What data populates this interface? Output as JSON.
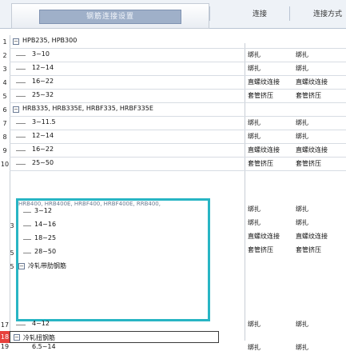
{
  "header": {
    "title": "钢筋连接设置",
    "col1": "连接",
    "col2": "连接方式"
  },
  "rows": [
    {
      "n": "1",
      "group": true,
      "label": "HPB235, HPB300"
    },
    {
      "n": "2",
      "label": "3~10",
      "c1": "绑扎",
      "c2": "绑扎"
    },
    {
      "n": "3",
      "label": "12~14",
      "c1": "绑扎",
      "c2": "绑扎"
    },
    {
      "n": "4",
      "label": "16~22",
      "c1": "直螺纹连接",
      "c2": "直螺纹连接"
    },
    {
      "n": "5",
      "label": "25~32",
      "c1": "套管挤压",
      "c2": "套管挤压"
    },
    {
      "n": "6",
      "group": true,
      "label": "HRB335, HRB335E, HRBF335, HRBF335E"
    },
    {
      "n": "7",
      "label": "3~11.5",
      "c1": "绑扎",
      "c2": "绑扎"
    },
    {
      "n": "8",
      "label": "12~14",
      "c1": "绑扎",
      "c2": "绑扎"
    },
    {
      "n": "9",
      "label": "16~22",
      "c1": "直螺纹连接",
      "c2": "直螺纹连接"
    },
    {
      "n": "10",
      "label": "25~50",
      "c1": "套管挤压",
      "c2": "套管挤压"
    }
  ],
  "popup": {
    "header": "HRB400, HRB400E, HRBF400, HRBF400E, RRB400,",
    "rows": [
      {
        "label": "3~12",
        "c1": "绑扎",
        "c2": "绑扎"
      },
      {
        "n": "3",
        "label": "14~16",
        "c1": "绑扎",
        "c2": "绑扎"
      },
      {
        "label": "18~25",
        "c1": "直螺纹连接",
        "c2": "直螺纹连接"
      },
      {
        "n": "5",
        "label": "28~50",
        "c1": "套管挤压",
        "c2": "套管挤压"
      },
      {
        "n": "5",
        "group": true,
        "label": "冷轧带肋钢筋"
      }
    ]
  },
  "tail_rows": [
    {
      "n": "17",
      "label": "4~12",
      "c1": "绑扎",
      "c2": "绑扎"
    },
    {
      "n": "18",
      "group": true,
      "label": "冷轧扭钢筋"
    },
    {
      "n": "19",
      "label": "6.5~14",
      "c1": "绑扎",
      "c2": "绑扎"
    }
  ]
}
